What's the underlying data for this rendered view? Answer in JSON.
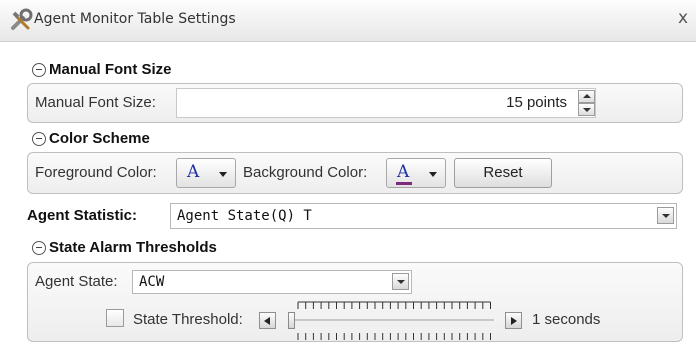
{
  "window": {
    "title": "Agent Monitor Table Settings",
    "close_glyph": "x"
  },
  "manual_font": {
    "header": "Manual Font Size",
    "label": "Manual Font Size:",
    "value": "15 points"
  },
  "color_scheme": {
    "header": "Color Scheme",
    "foreground_label": "Foreground Color:",
    "background_label": "Background Color:",
    "color_glyph": "A",
    "reset_label": "Reset",
    "foreground_color": "#1f2fa6",
    "background_underline_color": "#7d2a7a"
  },
  "agent_statistic": {
    "label": "Agent Statistic:",
    "value": "Agent State(Q) T"
  },
  "state_alarm": {
    "header": "State Alarm Thresholds",
    "agent_state_label": "Agent State:",
    "agent_state_value": "ACW",
    "threshold_label": "State Threshold:",
    "threshold_value": "1 seconds",
    "threshold_checked": false
  },
  "icons": [
    "settings-tools-icon",
    "close-icon",
    "collapse-icon",
    "chevron-up-icon",
    "chevron-down-icon",
    "dropdown-arrow-icon",
    "arrow-left-icon",
    "arrow-right-icon"
  ]
}
